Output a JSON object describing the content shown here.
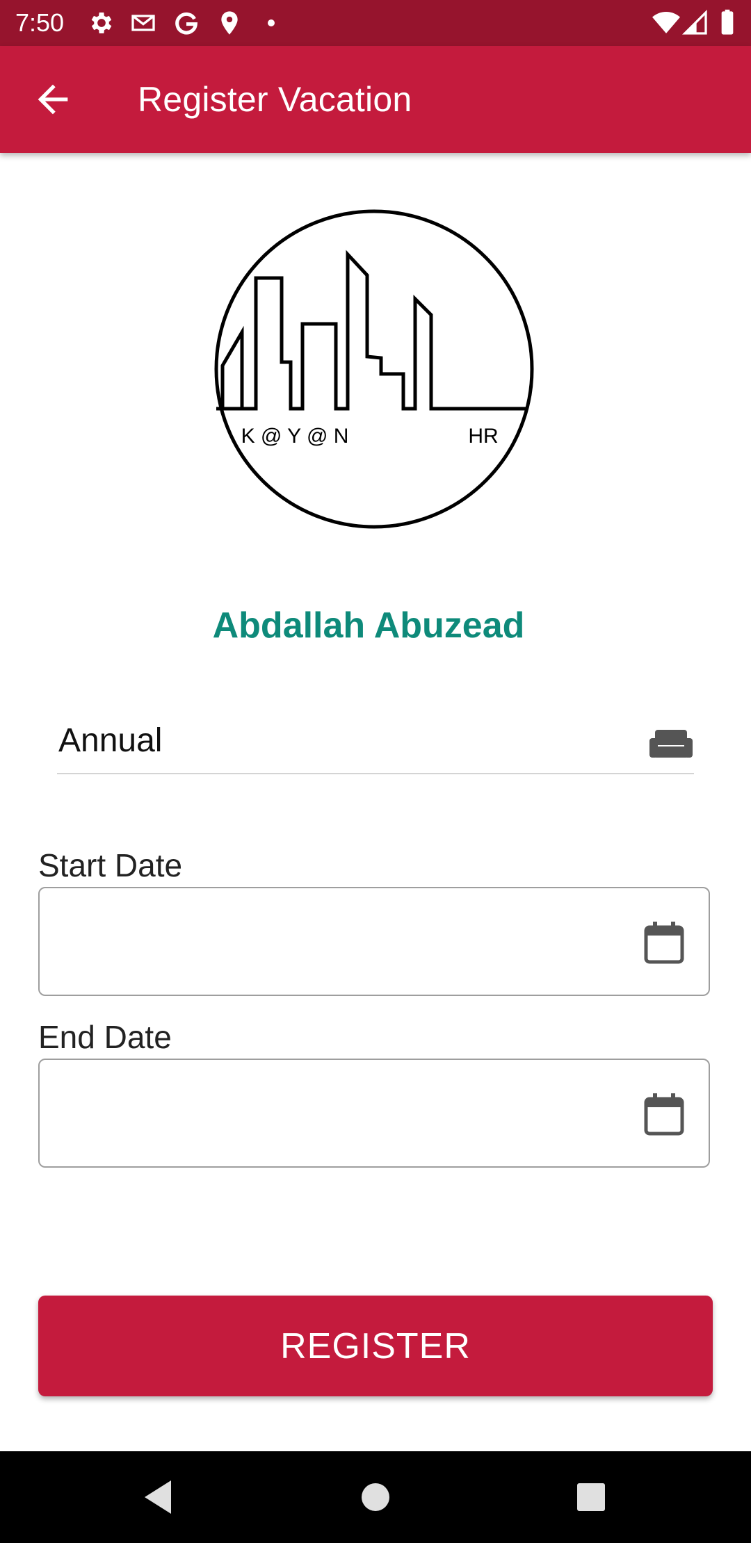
{
  "status_bar": {
    "time": "7:50",
    "left_icons": [
      "settings-icon",
      "gmail-icon",
      "google-icon",
      "location-icon",
      "dot-icon"
    ],
    "right_icons": [
      "wifi-icon",
      "signal-icon",
      "battery-icon"
    ]
  },
  "app_bar": {
    "back_icon": "arrow-back-icon",
    "title": "Register Vacation"
  },
  "logo": {
    "text_left": "K @ Y @ N",
    "text_right": "HR"
  },
  "employee": {
    "name": "Abdallah Abuzead"
  },
  "vacation_type": {
    "value": "Annual",
    "icon": "couch-icon"
  },
  "start_date": {
    "label": "Start Date",
    "value": "",
    "icon": "calendar-icon"
  },
  "end_date": {
    "label": "End Date",
    "value": "",
    "icon": "calendar-icon"
  },
  "actions": {
    "register_label": "REGISTER"
  },
  "nav_bar": {
    "icons": [
      "back-triangle-icon",
      "home-circle-icon",
      "recents-square-icon"
    ]
  },
  "colors": {
    "status_bar": "#96142d",
    "primary": "#c41b3d",
    "name_text": "#0e8a7a",
    "nav_bar": "#000000"
  }
}
